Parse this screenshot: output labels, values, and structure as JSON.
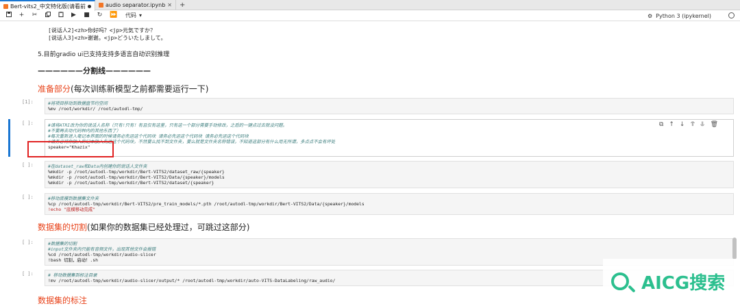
{
  "tabs": [
    {
      "label": "Bert-vits2_中文特化版(请看前",
      "active": true,
      "modified": true
    },
    {
      "label": "audio separator.ipynb",
      "active": false,
      "modified": false
    }
  ],
  "toolbar": {
    "cell_type": "代码",
    "kernel": "Python 3 (ipykernel)"
  },
  "notebook": {
    "md_line1": "[说话人2]<zh>你好吗？<jp>元気ですか？",
    "md_line2": "[说话人3]<zh>谢谢。<jp>どういたしまして。",
    "md_gradio": "5.目前gradio ui已支持支持多语言自动识别推理",
    "md_divider": "——————分割线——————",
    "h_prep": "准备部分",
    "h_prep_rest": "(每次训练新模型之前都需要运行一下)",
    "h_slice": "数据集的切割",
    "h_slice_rest": "(如果你的数据集已经处理过，可跳过这部分)",
    "h_label": "数据集的标注",
    "cells": [
      {
        "prompt": "[1]:",
        "lines": [
          {
            "t": "#将项目移动到数据盘节约空间",
            "k": "cm"
          },
          {
            "t": "%mv /root/workdir/ /root/autodl-tmp/",
            "k": ""
          }
        ]
      },
      {
        "prompt": "[ ]:",
        "lines": [
          {
            "t": "#请将ATRI改为你的说话人名称（只有!只有！有且仅有这里，只有这一个部分需要手动修改，之后的一键点过去就没问题。",
            "k": "cm"
          },
          {
            "t": "#不要再去动代码种内的其他东西了）",
            "k": "cm"
          },
          {
            "t": "#每次重新进入毫记本界面的时候请务必先运这个代码块 请务必先运这个代码块 请务必先运这个代码块",
            "k": "cm"
          },
          {
            "t": "#请务必将你放入的记本放入先运这个代码块，不然要么找不到文件夹，要么就是文件夹名称错误，不知道这部分有什么用无所谓，多点点不会有坏处",
            "k": "cm"
          },
          {
            "t": "speaker=\"Khazix\"",
            "k": ""
          }
        ]
      },
      {
        "prompt": "[ ]:",
        "lines": [
          {
            "t": "#在dataset_raw和Data内创建你的说话人文件夹",
            "k": "cm"
          },
          {
            "t": "%mkdir -p /root/autodl-tmp/workdir/Bert-VITS2/dataset_raw/{speaker}",
            "k": ""
          },
          {
            "t": "%mkdir -p /root/autodl-tmp/workdir/Bert-VITS2/Data/{speaker}/models",
            "k": ""
          },
          {
            "t": "%mkdir -p /root/autodl-tmp/workdir/Bert-VITS2/dataset/{speaker}",
            "k": ""
          }
        ]
      },
      {
        "prompt": "[ ]:",
        "lines": [
          {
            "t": "#移动底模到数据集文件夹",
            "k": "cm"
          },
          {
            "t": "%cp /root/autodl-tmp/workdir/Bert-VITS2/pre_train_models/*.pth /root/autodl-tmp/workdir/Bert-VITS2/Data/{speaker}/models",
            "k": ""
          },
          {
            "t": "!echo \"底模移动完成\"",
            "k": "str"
          }
        ]
      },
      {
        "prompt": "[ ]:",
        "lines": [
          {
            "t": "#数据集的切割",
            "k": "cm"
          },
          {
            "t": "#input文件夹内只能有音频文件，出现其他文件会报错",
            "k": "cm"
          },
          {
            "t": "%cd /root/autodl-tmp/workdir/audio-slicer",
            "k": ""
          },
          {
            "t": "!bash 切割，启动！.sh",
            "k": ""
          }
        ]
      },
      {
        "prompt": "[ ]:",
        "lines": [
          {
            "t": "# 移动数据集到标注目录",
            "k": "cm"
          },
          {
            "t": "!mv /root/autodl-tmp/workdir/audio-slicer/output/* /root/autodl-tmp/workdir/auto-VITS-DataLabeling/raw_audio/",
            "k": ""
          }
        ]
      }
    ]
  },
  "watermark": {
    "text": "AICG搜索"
  },
  "colors": {
    "accent": "#1976d2",
    "heading_red": "#e8431a",
    "highlight": "#e02020",
    "brand_green": "#2bbf8e"
  }
}
